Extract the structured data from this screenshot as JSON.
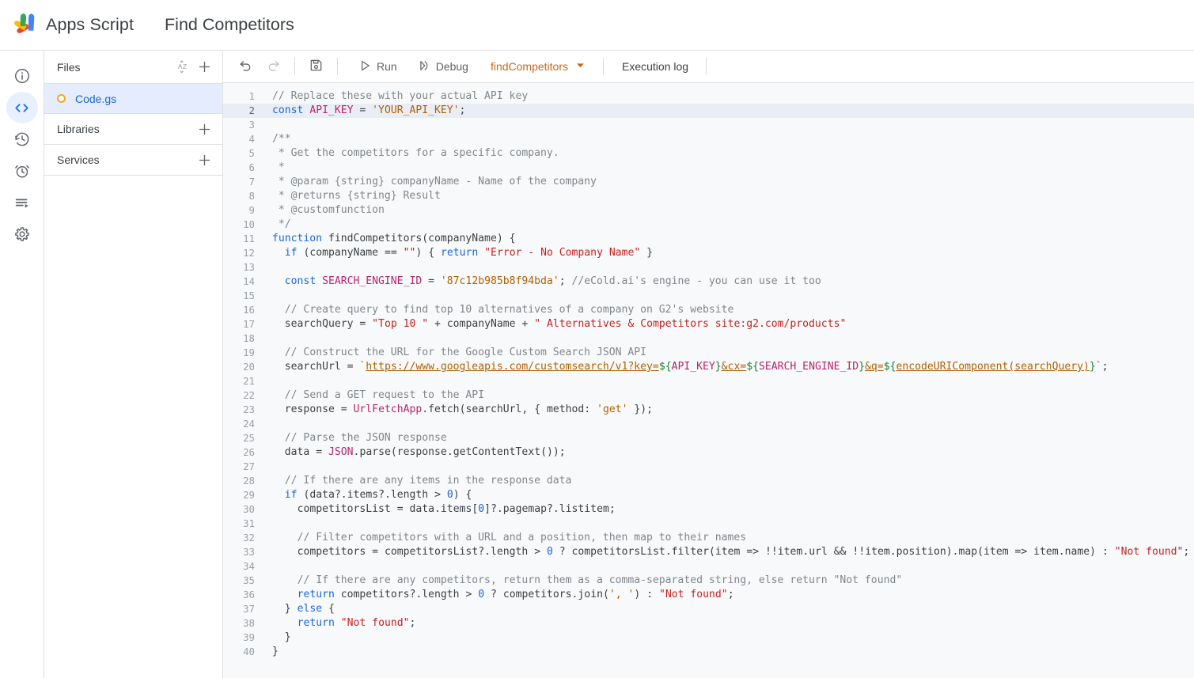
{
  "header": {
    "logo_icon": "apps-script-logo",
    "brand": "Apps Script",
    "project_title": "Find Competitors"
  },
  "rail": {
    "items": [
      {
        "name": "overview",
        "icon": "info-circle-icon",
        "active": false
      },
      {
        "name": "editor",
        "icon": "code-brackets-icon",
        "active": true
      },
      {
        "name": "project-history",
        "icon": "history-clock-icon",
        "active": false
      },
      {
        "name": "triggers",
        "icon": "alarm-clock-icon",
        "active": false
      },
      {
        "name": "executions",
        "icon": "executions-list-icon",
        "active": false
      },
      {
        "name": "project-settings",
        "icon": "gear-icon",
        "active": false
      }
    ]
  },
  "files_panel": {
    "header": {
      "label": "Files",
      "sort_icon": "sort-az-icon",
      "add_icon": "plus-icon"
    },
    "files": [
      {
        "name": "Code.gs",
        "status_icon": "orange-circle-icon",
        "selected": true
      }
    ],
    "sections": [
      {
        "label": "Libraries",
        "add_icon": "plus-icon"
      },
      {
        "label": "Services",
        "add_icon": "plus-icon"
      }
    ]
  },
  "toolbar": {
    "undo_label": "Undo",
    "redo_label": "Redo",
    "save_label": "Save project",
    "run_label": "Run",
    "debug_label": "Debug",
    "function_select": "findCompetitors",
    "execution_log_label": "Execution log"
  },
  "editor": {
    "active_line": 2,
    "total_lines": 40,
    "colors": {
      "comment": "#80868b",
      "keyword": "#1967d2",
      "variable": "#b4256e",
      "string_double": "#c5221f",
      "string_single": "#b06000",
      "number": "#1967d2",
      "plain": "#3c4043",
      "active_line_bg": "#e9eef6",
      "background": "#f8f9fa"
    },
    "lines": [
      {
        "n": 1,
        "text": "// Replace these with your actual API key"
      },
      {
        "n": 2,
        "text": "const API_KEY = 'YOUR_API_KEY';"
      },
      {
        "n": 3,
        "text": ""
      },
      {
        "n": 4,
        "text": "/**"
      },
      {
        "n": 5,
        "text": " * Get the competitors for a specific company."
      },
      {
        "n": 6,
        "text": " *"
      },
      {
        "n": 7,
        "text": " * @param {string} companyName - Name of the company"
      },
      {
        "n": 8,
        "text": " * @returns {string} Result"
      },
      {
        "n": 9,
        "text": " * @customfunction"
      },
      {
        "n": 10,
        "text": " */"
      },
      {
        "n": 11,
        "text": "function findCompetitors(companyName) {"
      },
      {
        "n": 12,
        "text": "  if (companyName == \"\") { return \"Error - No Company Name\" }"
      },
      {
        "n": 13,
        "text": ""
      },
      {
        "n": 14,
        "text": "  const SEARCH_ENGINE_ID = '87c12b985b8f94bda'; //eCold.ai's engine - you can use it too"
      },
      {
        "n": 15,
        "text": ""
      },
      {
        "n": 16,
        "text": "  // Create query to find top 10 alternatives of a company on G2's website"
      },
      {
        "n": 17,
        "text": "  searchQuery = \"Top 10 \" + companyName + \" Alternatives & Competitors site:g2.com/products\""
      },
      {
        "n": 18,
        "text": ""
      },
      {
        "n": 19,
        "text": "  // Construct the URL for the Google Custom Search JSON API"
      },
      {
        "n": 20,
        "text": "  searchUrl = `https://www.googleapis.com/customsearch/v1?key=${API_KEY}&cx=${SEARCH_ENGINE_ID}&q=${encodeURIComponent(searchQuery)}`;"
      },
      {
        "n": 21,
        "text": ""
      },
      {
        "n": 22,
        "text": "  // Send a GET request to the API"
      },
      {
        "n": 23,
        "text": "  response = UrlFetchApp.fetch(searchUrl, { method: 'get' });"
      },
      {
        "n": 24,
        "text": ""
      },
      {
        "n": 25,
        "text": "  // Parse the JSON response"
      },
      {
        "n": 26,
        "text": "  data = JSON.parse(response.getContentText());"
      },
      {
        "n": 27,
        "text": ""
      },
      {
        "n": 28,
        "text": "  // If there are any items in the response data"
      },
      {
        "n": 29,
        "text": "  if (data?.items?.length > 0) {"
      },
      {
        "n": 30,
        "text": "    competitorsList = data.items[0]?.pagemap?.listitem;"
      },
      {
        "n": 31,
        "text": ""
      },
      {
        "n": 32,
        "text": "    // Filter competitors with a URL and a position, then map to their names"
      },
      {
        "n": 33,
        "text": "    competitors = competitorsList?.length > 0 ? competitorsList.filter(item => !!item.url && !!item.position).map(item => item.name) : \"Not found\";"
      },
      {
        "n": 34,
        "text": ""
      },
      {
        "n": 35,
        "text": "    // If there are any competitors, return them as a comma-separated string, else return \"Not found\""
      },
      {
        "n": 36,
        "text": "    return competitors?.length > 0 ? competitors.join(', ') : \"Not found\";"
      },
      {
        "n": 37,
        "text": "  } else {"
      },
      {
        "n": 38,
        "text": "    return \"Not found\";"
      },
      {
        "n": 39,
        "text": "  }"
      },
      {
        "n": 40,
        "text": "}"
      }
    ]
  }
}
